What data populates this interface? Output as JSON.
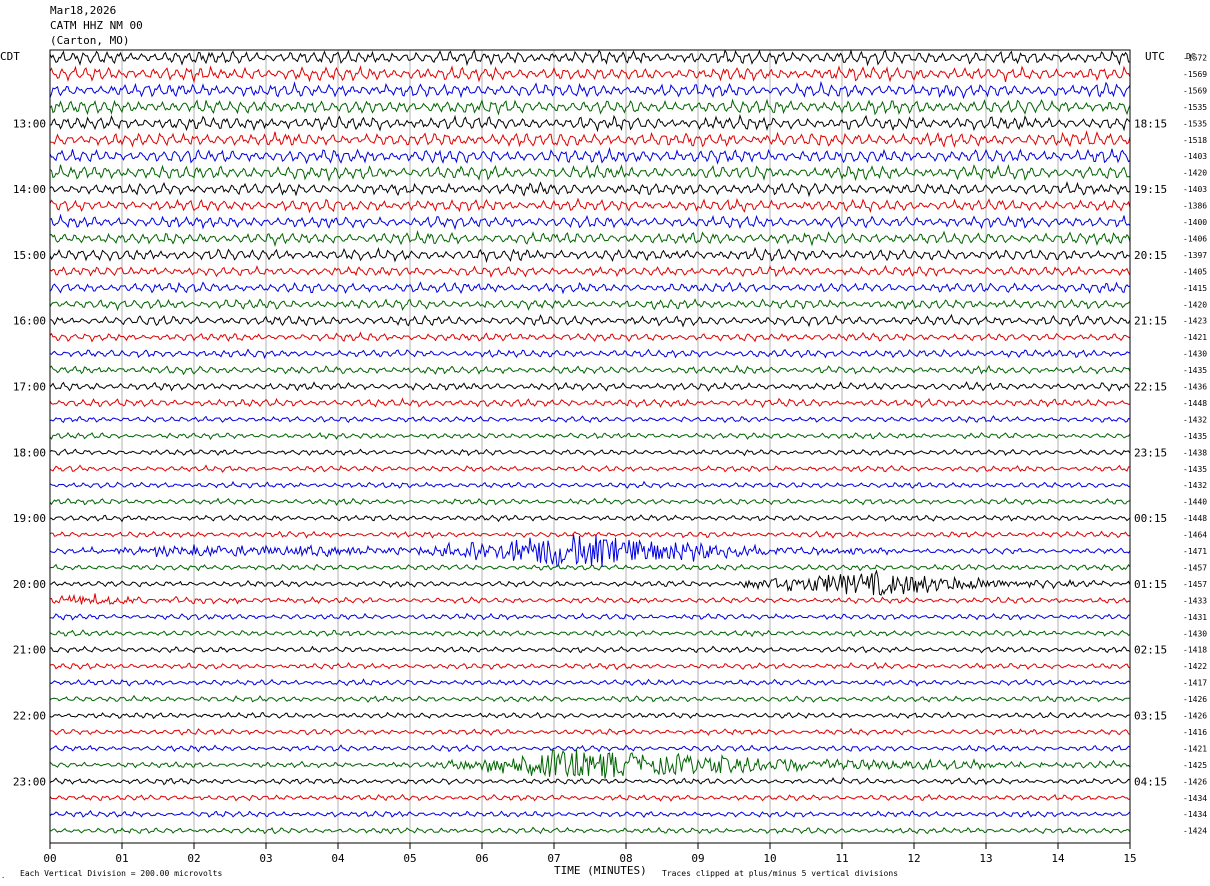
{
  "header": {
    "date": "Mar18,2026",
    "station": "CATM HHZ NM 00",
    "location": "(Carton, MO)"
  },
  "left_axis_label": "CDT",
  "right_axis_label": "UTC",
  "dc_label": "DC",
  "footer": {
    "scale_note": "Each Vertical Division =  200.00 microvolts",
    "xlabel": "TIME (MINUTES)",
    "clip_note": "Traces clipped at plus/minus 5 vertical divisions"
  },
  "colors": {
    "trace_cycle": [
      "#000000",
      "#e00000",
      "#0000e0",
      "#006400"
    ],
    "grid": "#808080"
  },
  "chart_data": {
    "type": "line",
    "title": "CATM HHZ NM 00 (Carton, MO) Mar18,2026",
    "xlabel": "TIME (MINUTES)",
    "x_ticks": [
      "00",
      "01",
      "02",
      "03",
      "04",
      "05",
      "06",
      "07",
      "08",
      "09",
      "10",
      "11",
      "12",
      "13",
      "14",
      "15"
    ],
    "xlim": [
      0,
      15
    ],
    "rows_per_hour": 4,
    "left_hour_labels": [
      "13:00",
      "14:00",
      "15:00",
      "16:00",
      "17:00",
      "18:00",
      "19:00",
      "20:00",
      "21:00",
      "22:00",
      "23:00"
    ],
    "right_hour_labels": [
      "18:15",
      "19:15",
      "20:15",
      "21:15",
      "22:15",
      "23:15",
      "00:15",
      "01:15",
      "02:15",
      "03:15",
      "04:15"
    ],
    "first_labeled_row": 4,
    "dc_offsets": [
      -1572,
      -1569,
      -1569,
      -1535,
      -1535,
      -1518,
      -1403,
      -1420,
      -1403,
      -1386,
      -1400,
      -1406,
      -1397,
      -1405,
      -1415,
      -1420,
      -1423,
      -1421,
      -1430,
      -1435,
      -1436,
      -1448,
      -1432,
      -1435,
      -1438,
      -1435,
      -1432,
      -1440,
      -1448,
      -1464,
      -1471,
      -1457,
      -1457,
      -1433,
      -1431,
      -1430,
      -1418,
      -1422,
      -1417,
      -1426,
      -1426,
      -1416,
      -1421,
      -1425,
      -1426,
      -1434,
      -1434,
      -1424
    ],
    "trace_amplitude": [
      7,
      7,
      7,
      7,
      7,
      7,
      7,
      7,
      6,
      6,
      6,
      6,
      6,
      5,
      5,
      5,
      5,
      4,
      4,
      4,
      4,
      4,
      3,
      3,
      3,
      3,
      3,
      3,
      3,
      3,
      3,
      3,
      3,
      3,
      3,
      3,
      3,
      3,
      3,
      3,
      3,
      3,
      3,
      3,
      3,
      3,
      3,
      3
    ],
    "events": [
      {
        "row": 30,
        "start_min": 5.0,
        "peak_min": 7.3,
        "end_min": 11.5,
        "amplitude": 18
      },
      {
        "row": 32,
        "start_min": 9.2,
        "peak_min": 11.5,
        "end_min": 15.0,
        "amplitude": 12
      },
      {
        "row": 43,
        "start_min": 5.2,
        "peak_min": 7.2,
        "end_min": 15.0,
        "amplitude": 15
      },
      {
        "row": 33,
        "start_min": 0.0,
        "peak_min": 0.3,
        "end_min": 4.0,
        "amplitude": 5
      },
      {
        "row": 30,
        "start_min": 0.0,
        "peak_min": 2.0,
        "end_min": 15.0,
        "amplitude": 5
      }
    ],
    "unit_note": "Each Vertical Division =  200.00 microvolts"
  }
}
